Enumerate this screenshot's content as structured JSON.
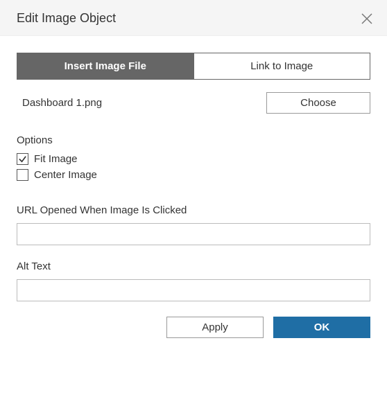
{
  "header": {
    "title": "Edit Image Object"
  },
  "tabs": {
    "insert": "Insert Image File",
    "link": "Link to Image"
  },
  "file": {
    "name": "Dashboard 1.png",
    "choose_label": "Choose"
  },
  "options": {
    "label": "Options",
    "fit_label": "Fit Image",
    "center_label": "Center Image",
    "fit_checked": true,
    "center_checked": false
  },
  "url": {
    "label": "URL Opened When Image Is Clicked",
    "value": ""
  },
  "alt": {
    "label": "Alt Text",
    "value": ""
  },
  "footer": {
    "apply": "Apply",
    "ok": "OK"
  }
}
